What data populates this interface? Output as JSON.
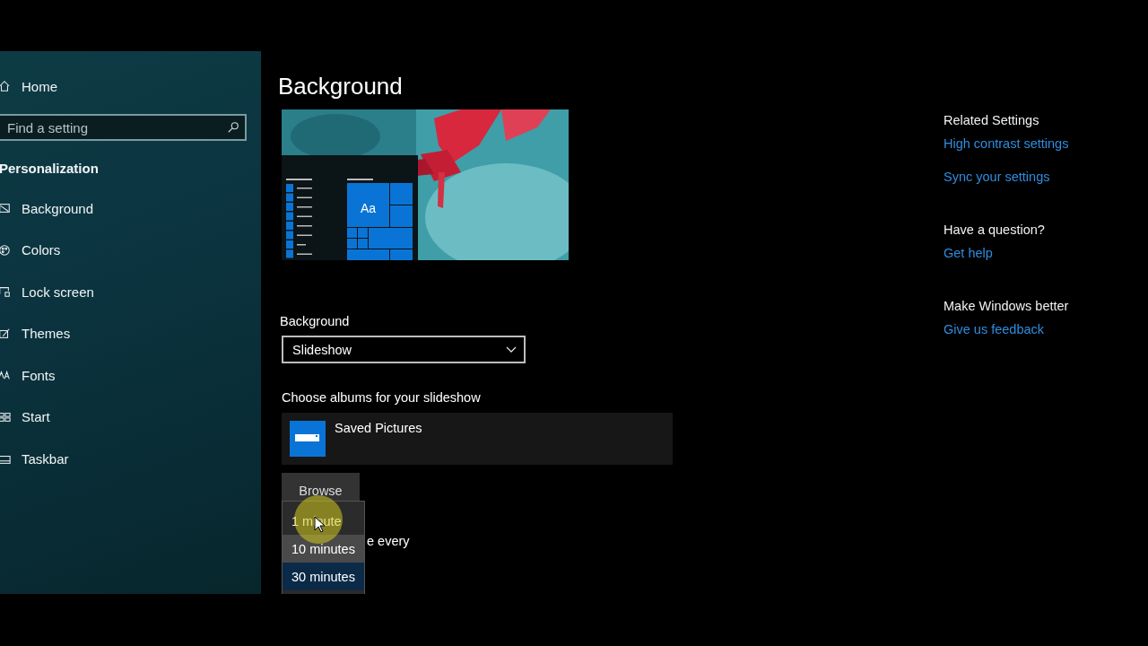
{
  "sidebar": {
    "home": "Home",
    "search": {
      "placeholder": "Find a setting"
    },
    "section": "Personalization",
    "items": [
      {
        "label": "Background",
        "selected": false
      },
      {
        "label": "Colors",
        "selected": false
      },
      {
        "label": "Lock screen",
        "selected": false
      },
      {
        "label": "Themes",
        "selected": false
      },
      {
        "label": "Fonts",
        "selected": false
      },
      {
        "label": "Start",
        "selected": false
      },
      {
        "label": "Taskbar",
        "selected": false
      }
    ]
  },
  "main": {
    "title": "Background",
    "preview": {
      "tile_label": "Aa"
    },
    "background_field": {
      "label": "Background",
      "value": "Slideshow"
    },
    "albums": {
      "label": "Choose albums for your slideshow",
      "items": [
        {
          "name": "Saved Pictures"
        }
      ],
      "browse": "Browse"
    },
    "interval_label": "e every",
    "interval_menu": {
      "options": [
        {
          "label": "1 minute",
          "selected": false,
          "hovered": false
        },
        {
          "label": "10 minutes",
          "selected": false,
          "hovered": true
        },
        {
          "label": "30 minutes",
          "selected": true,
          "hovered": false
        }
      ]
    }
  },
  "related": [
    {
      "heading": "Related Settings",
      "links": [
        "High contrast settings",
        "Sync your settings"
      ]
    },
    {
      "heading": "Have a question?",
      "links": [
        "Get help"
      ]
    },
    {
      "heading": "Make Windows better",
      "links": [
        "Give us feedback"
      ]
    }
  ]
}
